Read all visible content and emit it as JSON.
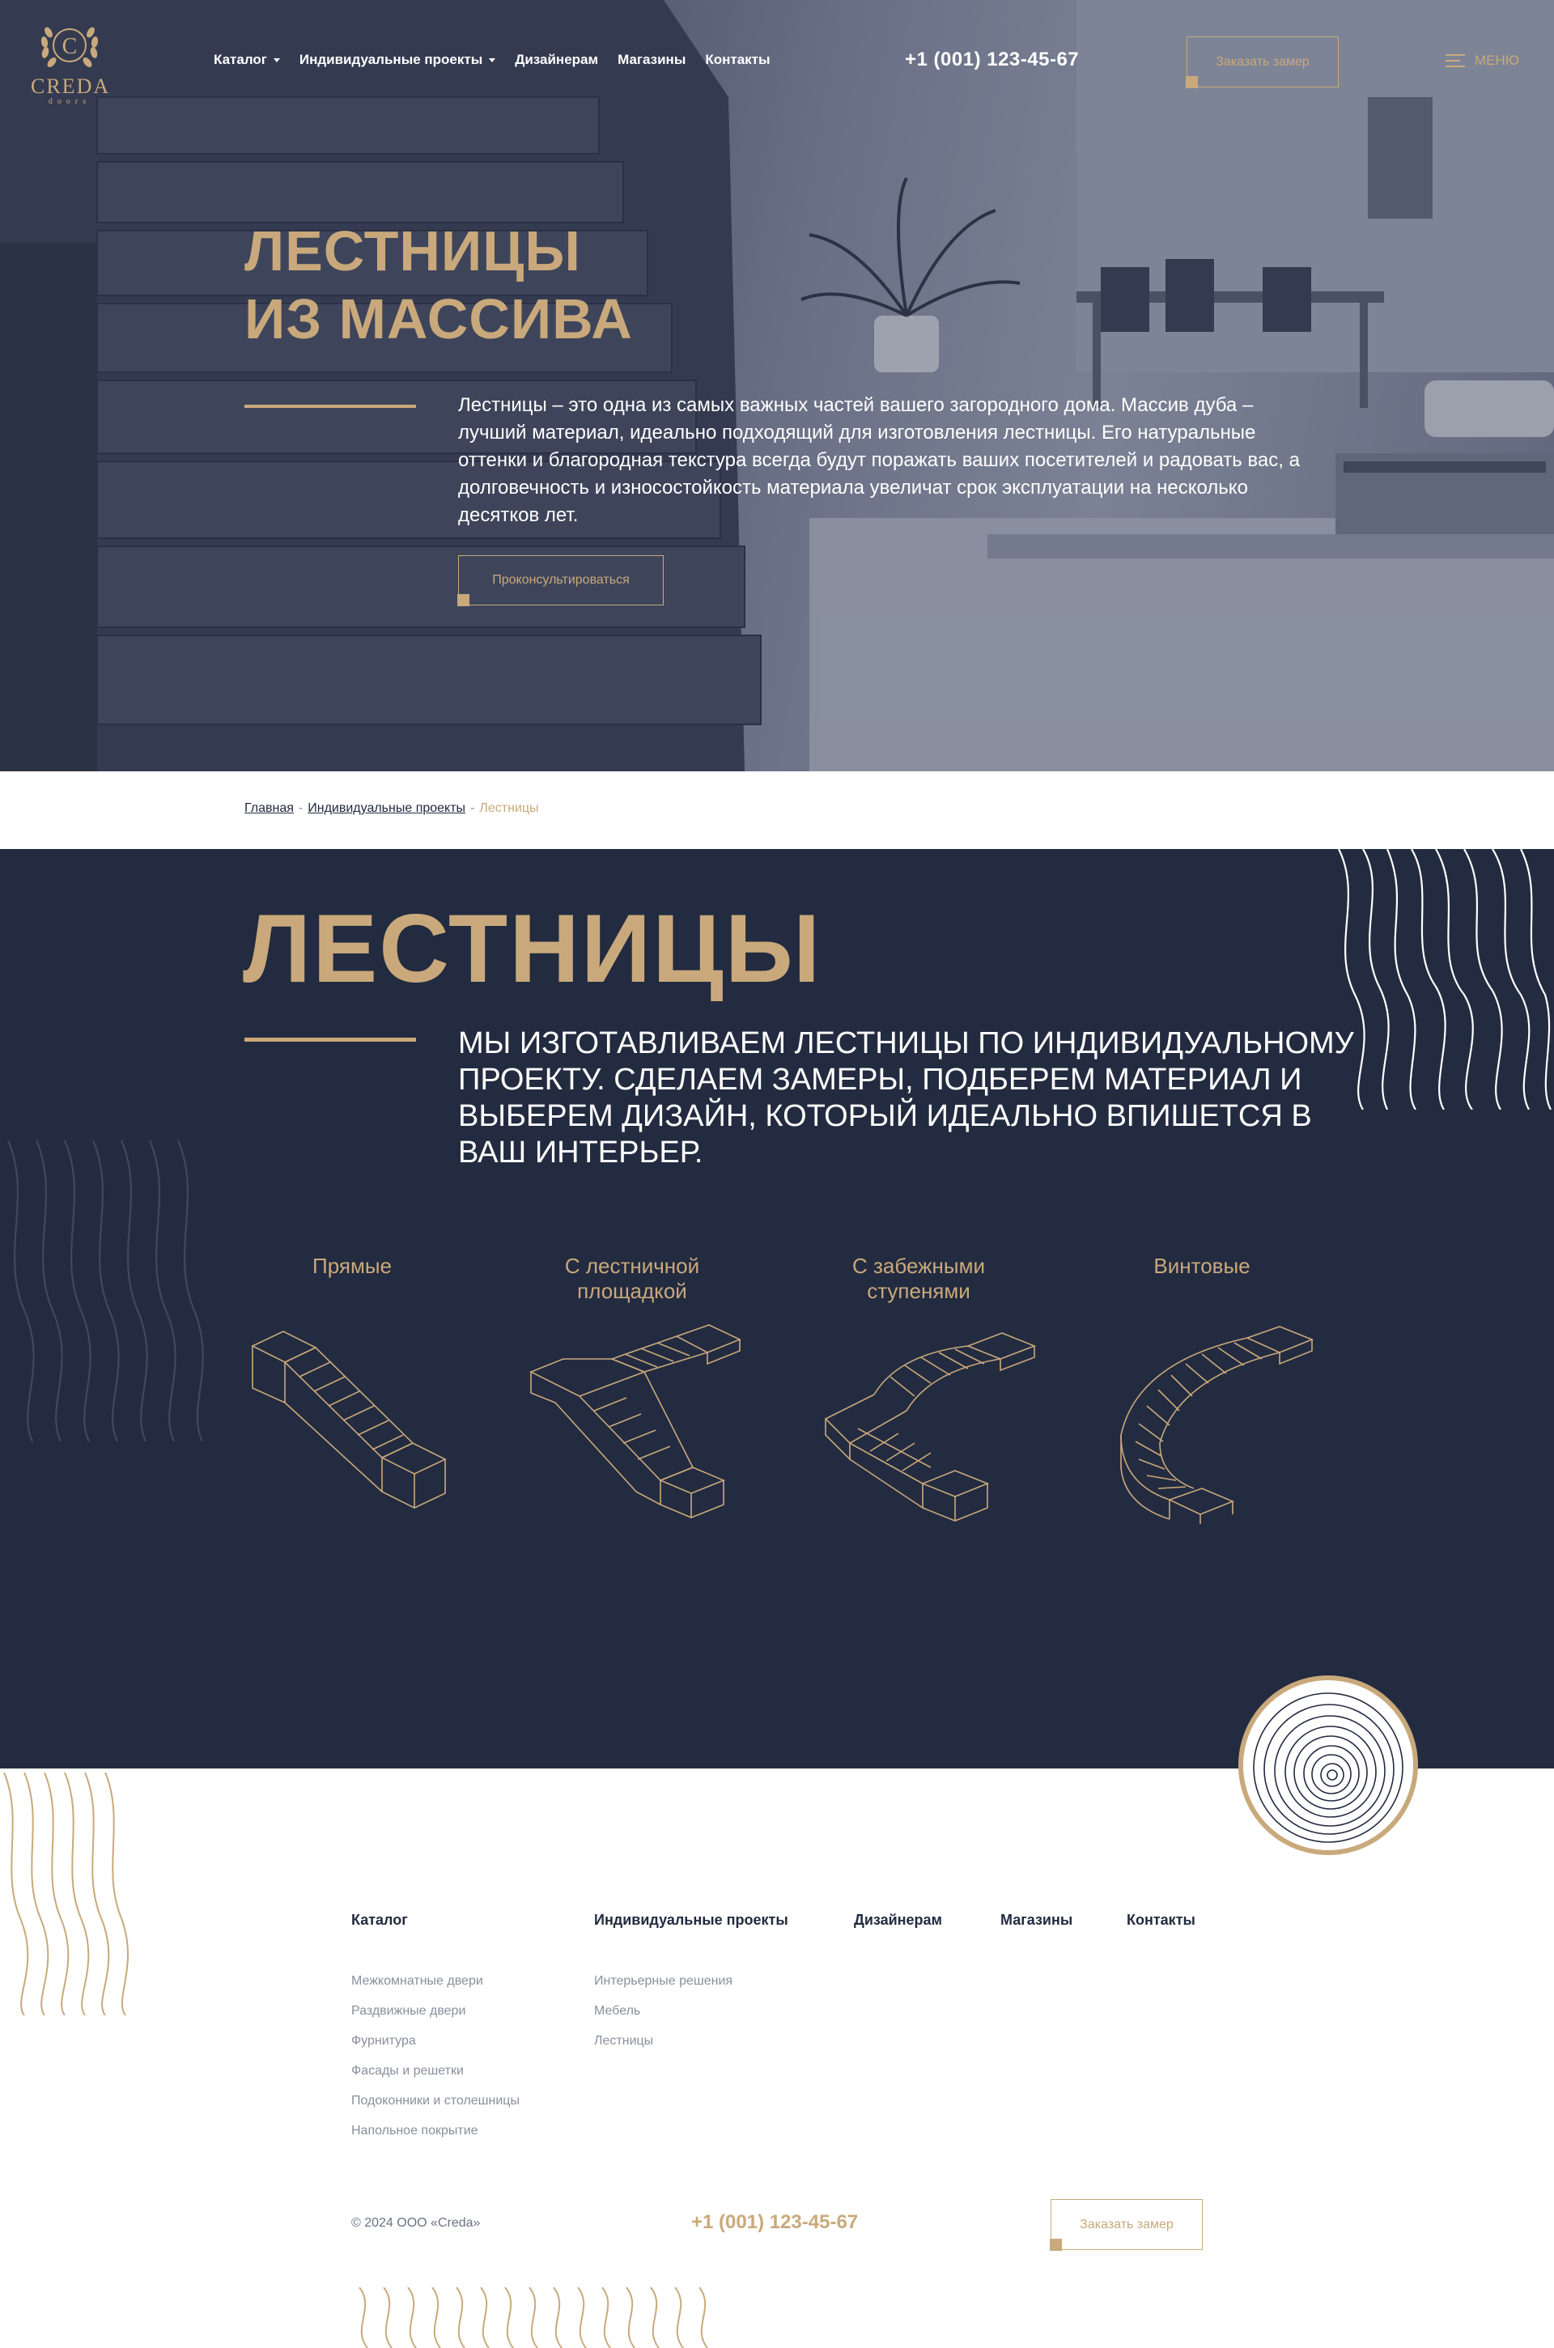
{
  "header": {
    "logo": {
      "word": "CREDA",
      "sub": "doors"
    },
    "nav": [
      {
        "label": "Каталог",
        "dropdown": true
      },
      {
        "label": "Индивидуальные проекты",
        "dropdown": true
      },
      {
        "label": "Дизайнерам",
        "dropdown": false
      },
      {
        "label": "Магазины",
        "dropdown": false
      },
      {
        "label": "Контакты",
        "dropdown": false
      }
    ],
    "phone": "+1 (001) 123-45-67",
    "order_button": "Заказать замер",
    "menu_label": "МЕНЮ"
  },
  "hero": {
    "title_line1": "ЛЕСТНИЦЫ",
    "title_line2": "ИЗ МАССИВА",
    "text": "Лестницы – это одна из самых важных частей вашего загородного дома. Массив дуба – лучший материал, идеально подходящий для изготовления лестницы. Его натуральные оттенки и благородная текстура всегда будут поражать ваших посетителей и радовать вас, а долговечность и износостойкость материала увеличат срок эксплуатации на несколько десятков лет.",
    "consult_button": "Проконсультироваться"
  },
  "breadcrumb": {
    "items": [
      "Главная",
      "Индивидуальные проекты"
    ],
    "separator": "-",
    "current": "Лестницы"
  },
  "stairs": {
    "title": "ЛЕСТНИЦЫ",
    "lead": "Мы изготавливаем лестницы по индивидуальному проекту. Сделаем замеры, подберем материал и выберем дизайн, который идеально впишется в ваш интерьер.",
    "types": [
      {
        "label": "Прямые",
        "icon": "straight-stair-icon"
      },
      {
        "label": "С лестничной площадкой",
        "icon": "landing-stair-icon"
      },
      {
        "label": "С забежными ступенями",
        "icon": "winder-stair-icon"
      },
      {
        "label": "Винтовые",
        "icon": "spiral-stair-icon"
      }
    ]
  },
  "footer": {
    "columns": [
      {
        "head": "Каталог",
        "links": [
          "Межкомнатные двери",
          "Раздвижные двери",
          "Фурнитура",
          "Фасады и решетки",
          "Подоконники и столешницы",
          "Напольное покрытие"
        ]
      },
      {
        "head": "Индивидуальные проекты",
        "links": [
          "Интерьерные решения",
          "Мебель",
          "Лестницы"
        ]
      },
      {
        "head": "Дизайнерам",
        "links": []
      },
      {
        "head": "Магазины",
        "links": []
      },
      {
        "head": "Контакты",
        "links": []
      }
    ],
    "copyright": "© 2024 ООО «Creda»",
    "phone": "+1 (001) 123-45-67",
    "order_button": "Заказать замер"
  },
  "colors": {
    "accent": "#c9a97b",
    "dark": "#232b40",
    "muted": "#8a8f9c",
    "white": "#ffffff"
  }
}
